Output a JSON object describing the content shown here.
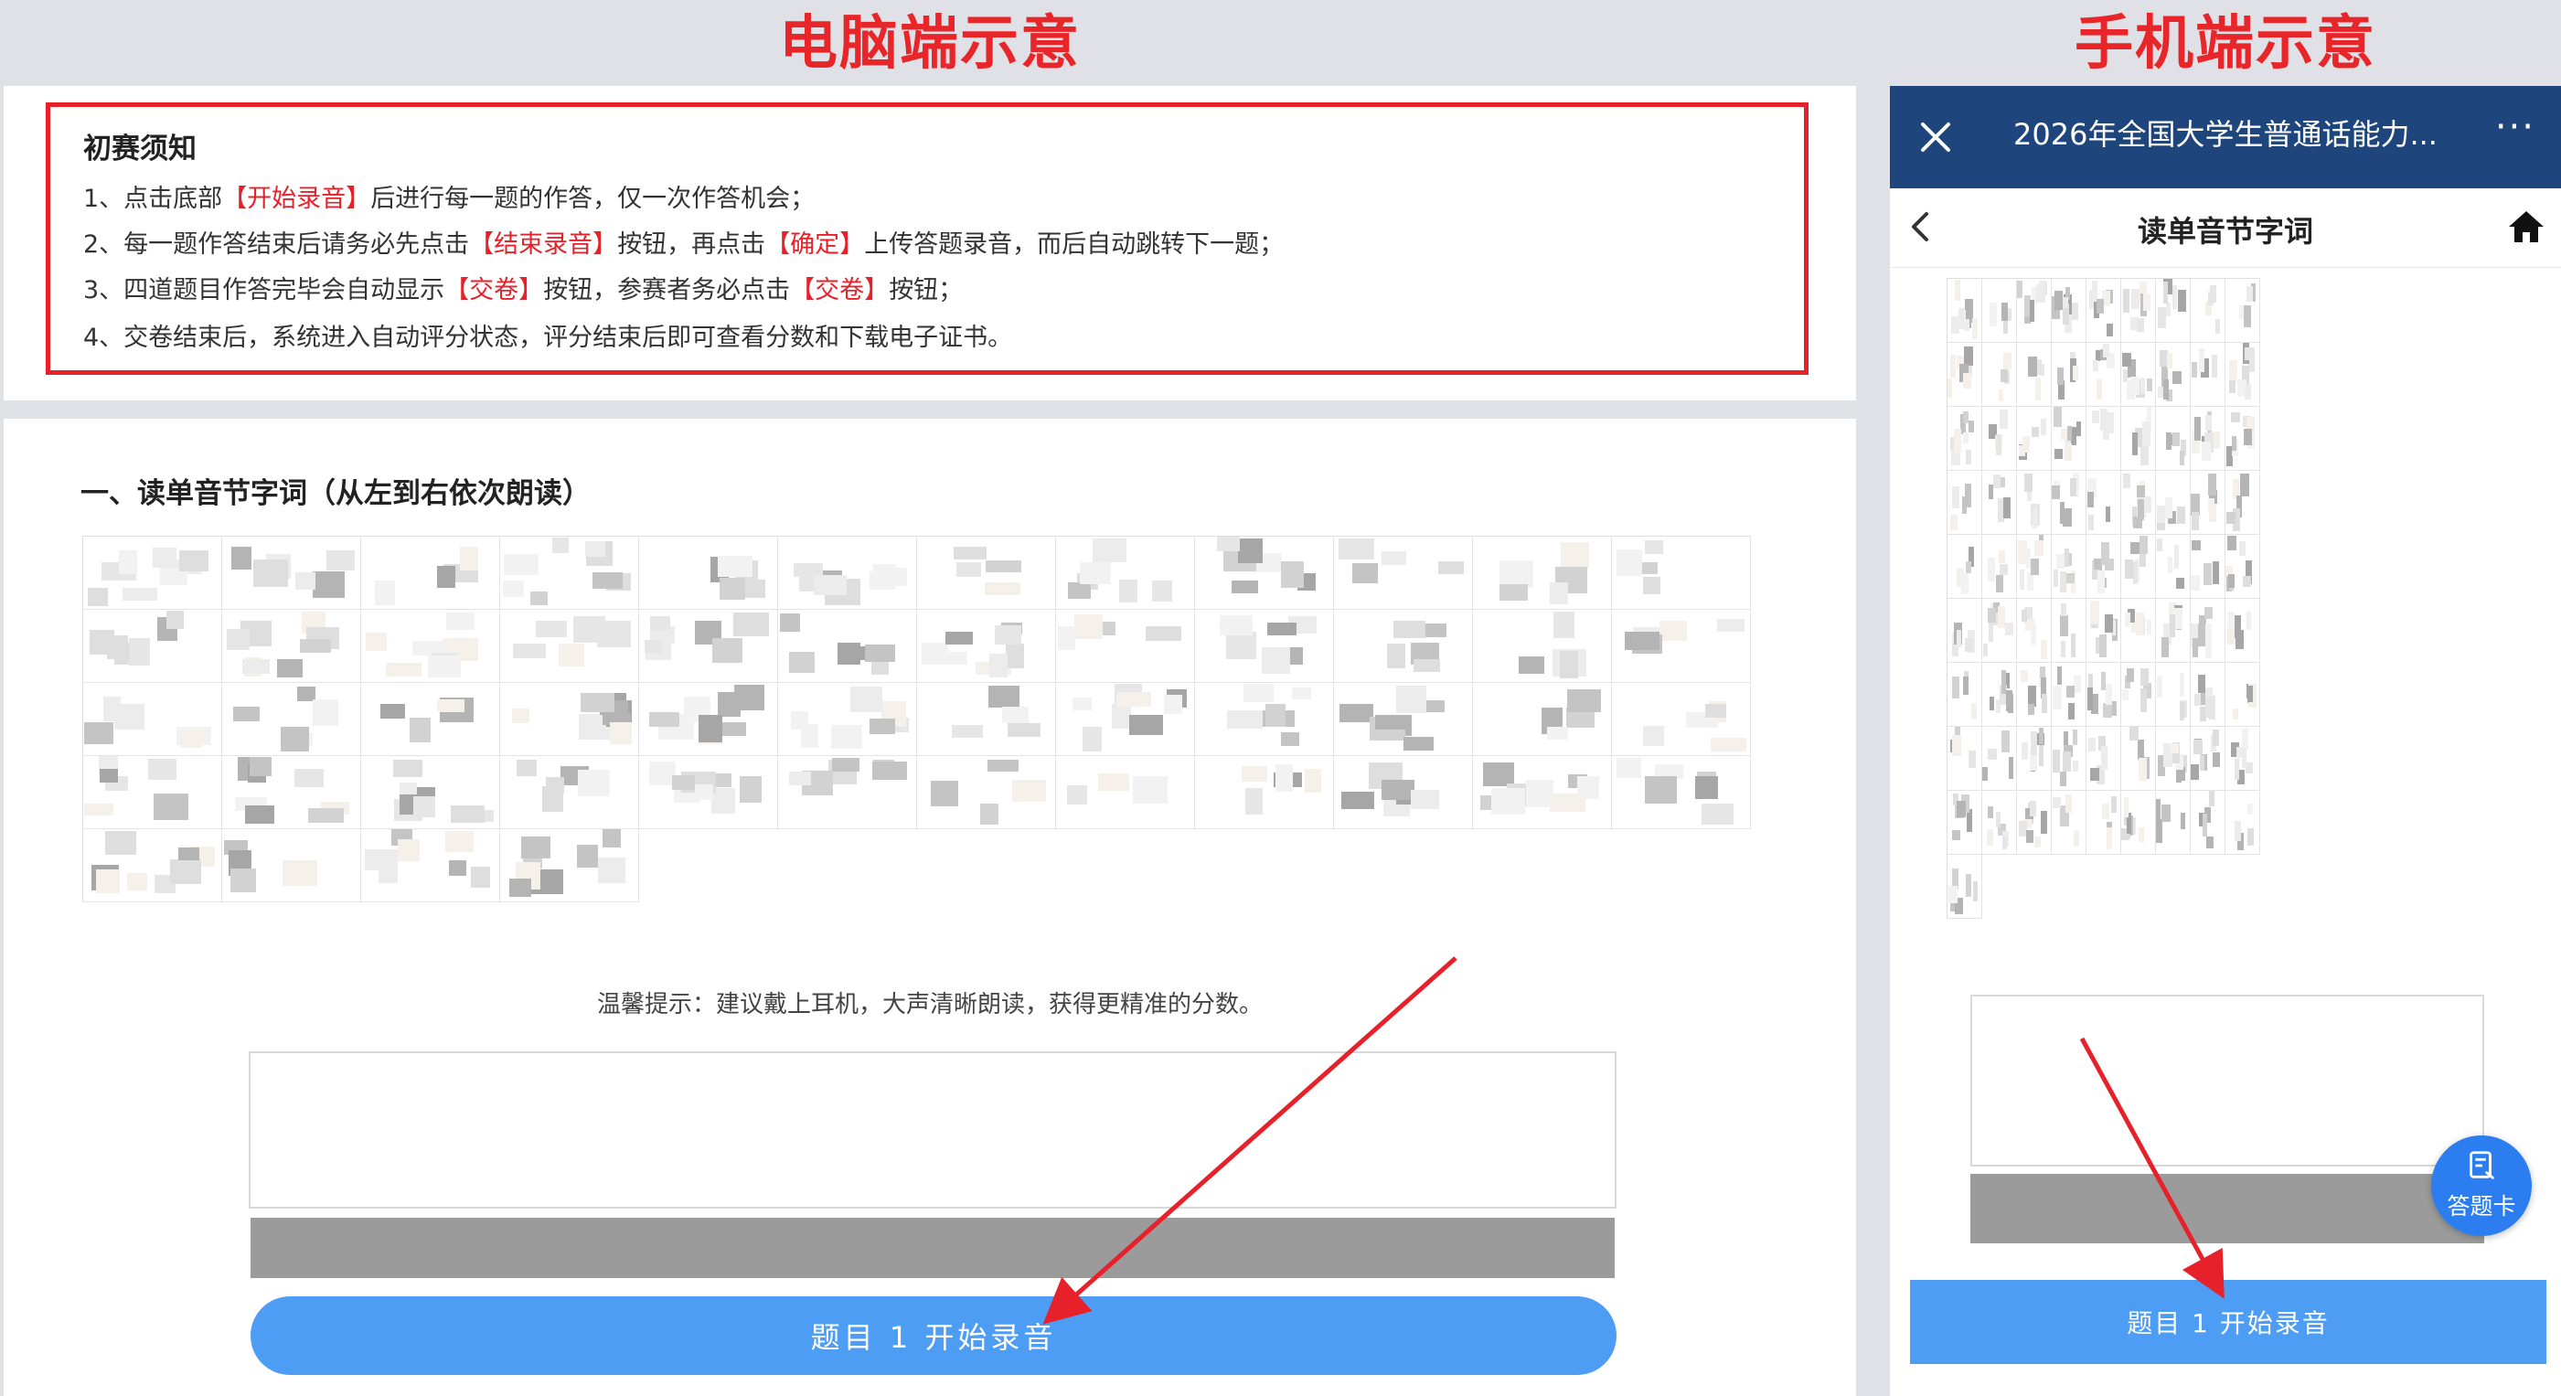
{
  "captions": {
    "desktop": "电脑端示意",
    "mobile": "手机端示意"
  },
  "notice": {
    "title": "初赛须知",
    "lines": [
      [
        {
          "t": "1、点击底部"
        },
        {
          "t": "【开始录音】",
          "red": true
        },
        {
          "t": "后进行每一题的作答，仅一次作答机会；"
        }
      ],
      [
        {
          "t": "2、每一题作答结束后请务必先点击"
        },
        {
          "t": "【结束录音】",
          "red": true
        },
        {
          "t": "按钮，再点击"
        },
        {
          "t": "【确定】",
          "red": true
        },
        {
          "t": "上传答题录音，而后自动跳转下一题；"
        }
      ],
      [
        {
          "t": "3、四道题目作答完毕会自动显示"
        },
        {
          "t": "【交卷】",
          "red": true
        },
        {
          "t": "按钮，参赛者务必点击"
        },
        {
          "t": "【交卷】",
          "red": true
        },
        {
          "t": "按钮；"
        }
      ],
      [
        {
          "t": "4、交卷结束后，系统进入自动评分状态，评分结束后即可查看分数和下载电子证书。"
        }
      ]
    ]
  },
  "desktop": {
    "section_title": "一、读单音节字词（从左到右依次朗读）",
    "tip": "温馨提示：建议戴上耳机，大声清晰朗读，获得更精准的分数。",
    "start_button": "题目 1 开始录音"
  },
  "mobile": {
    "app_title": "2026年全国大学生普通话能力...",
    "more": "···",
    "page_title": "读单音节字词",
    "fab_label": "答题卡",
    "start_button": "题目 1 开始录音"
  },
  "colors": {
    "accent_red": "#e62129",
    "header_blue": "#1e467c",
    "button_blue": "#4d9df5",
    "fab_blue": "#2c7ef0",
    "bar_gray": "#9b9b9b"
  },
  "icons": [
    "close-icon",
    "more-icon",
    "back-chevron-icon",
    "home-icon",
    "answer-card-icon"
  ]
}
